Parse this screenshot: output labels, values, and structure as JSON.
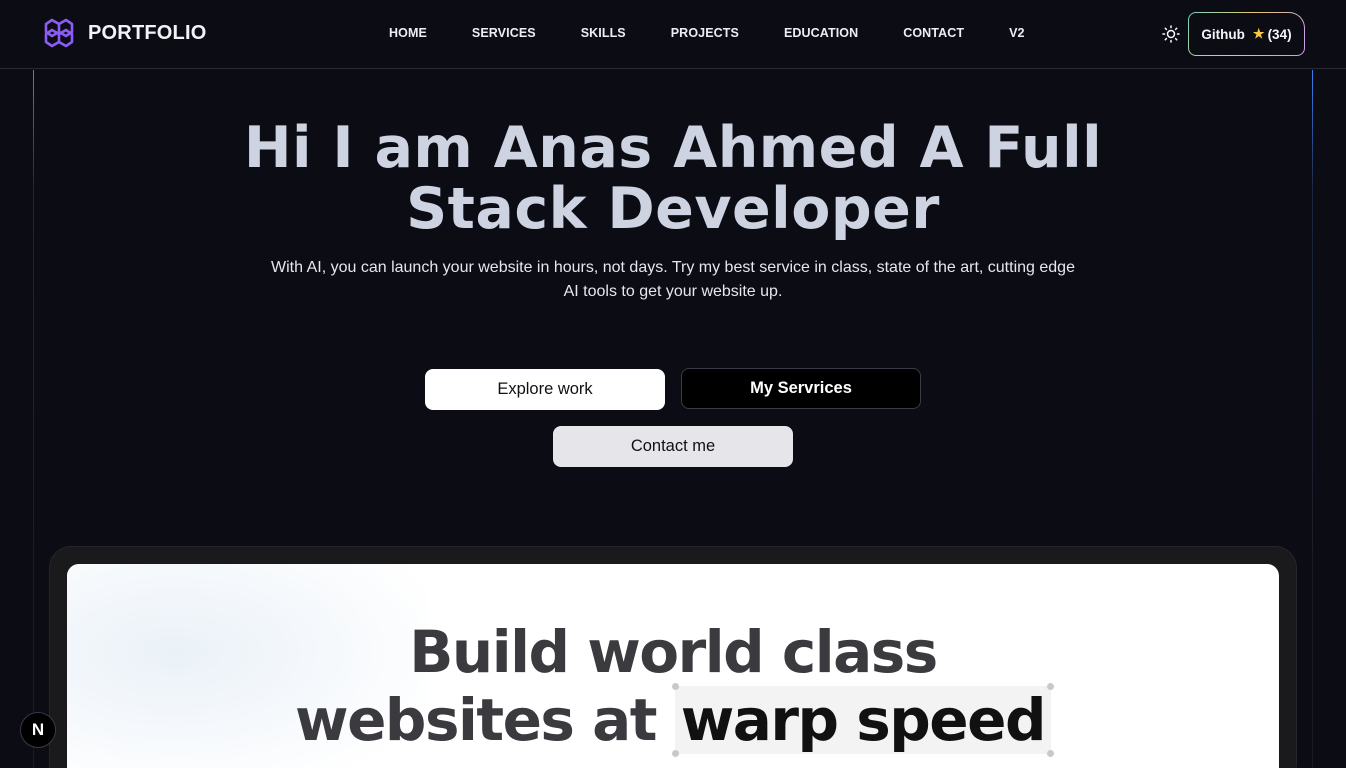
{
  "brand": {
    "name": "PORTFOLIO",
    "logo_icon": "knot-logo-icon",
    "logo_color": "#8b5cf6"
  },
  "nav": {
    "items": [
      {
        "label": "HOME"
      },
      {
        "label": "SERVICES"
      },
      {
        "label": "SKILLS"
      },
      {
        "label": "PROJECTS"
      },
      {
        "label": "EDUCATION"
      },
      {
        "label": "CONTACT"
      },
      {
        "label": "V2"
      }
    ]
  },
  "header": {
    "theme_icon": "sun-icon",
    "github": {
      "label": "Github",
      "star": "★",
      "count": "(34)"
    }
  },
  "hero": {
    "title": "Hi I am Anas Ahmed A Full Stack Developer",
    "subtitle": "With AI, you can launch your website in hours, not days. Try my best service in class, state of the art, cutting edge AI tools to get your website up.",
    "buttons": {
      "explore": "Explore work",
      "services": "My Servrices",
      "contact": "Contact me"
    }
  },
  "preview": {
    "title_line1": "Build world class",
    "title_line2_prefix": "websites at",
    "title_highlight": "warp speed"
  },
  "badge": {
    "label": "N",
    "icon": "nextjs-icon"
  },
  "colors": {
    "background": "#0c0c15",
    "hero_text": "#cdd3e0",
    "accent": "#8b5cf6"
  }
}
